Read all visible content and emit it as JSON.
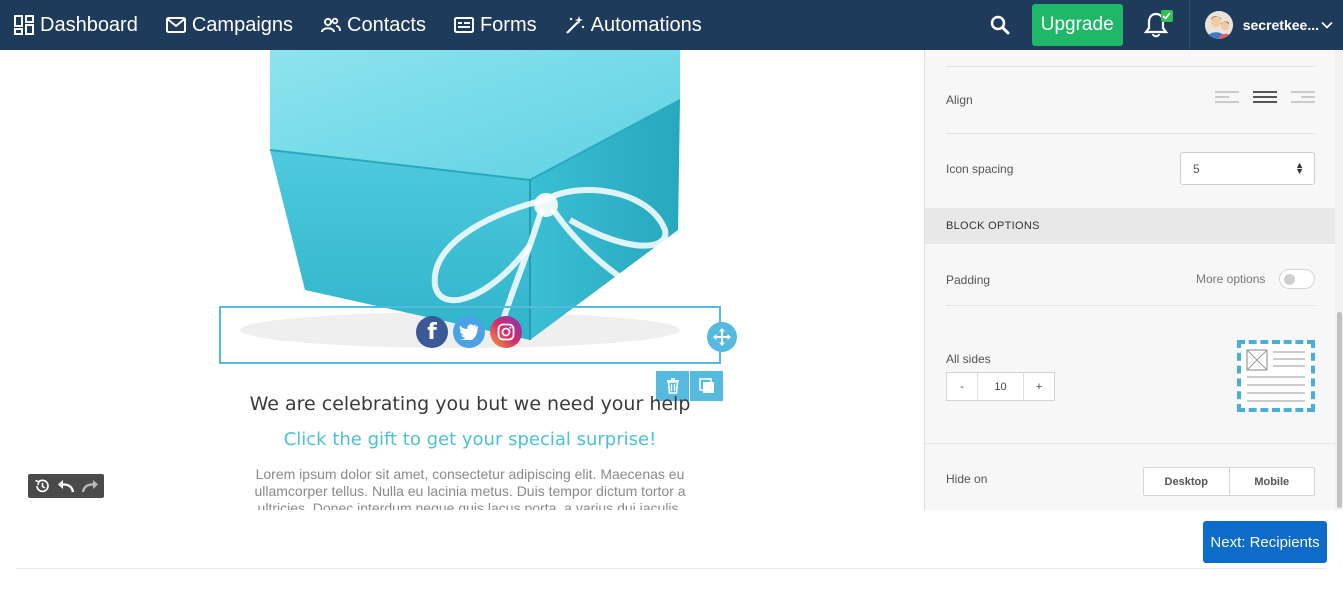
{
  "nav": {
    "items": [
      {
        "label": "Dashboard",
        "icon": "dashboard-icon"
      },
      {
        "label": "Campaigns",
        "icon": "mail-icon"
      },
      {
        "label": "Contacts",
        "icon": "contacts-icon"
      },
      {
        "label": "Forms",
        "icon": "form-icon"
      },
      {
        "label": "Automations",
        "icon": "magic-wand-icon"
      }
    ],
    "upgrade_label": "Upgrade",
    "user_name": "secretkee...",
    "colors": {
      "bar": "#1f3b5c",
      "upgrade": "#1fb868"
    }
  },
  "canvas": {
    "heading": "We are celebrating you but we need your help",
    "subheading": "Click the gift to get your special surprise!",
    "body": "Lorem ipsum dolor sit amet, consectetur adipiscing elit. Maecenas eu ullamcorper tellus. Nulla eu lacinia metus. Duis tempor dictum tortor a ultricies. Donec interdum neque quis lacus porta, a varius dui iaculis.",
    "social": [
      "facebook",
      "twitter",
      "instagram"
    ],
    "accent": "#55b9e0"
  },
  "panel": {
    "align_label": "Align",
    "icon_spacing_label": "Icon spacing",
    "icon_spacing_value": "5",
    "block_options_title": "BLOCK OPTIONS",
    "padding_label": "Padding",
    "more_options_label": "More options",
    "all_sides_label": "All sides",
    "minus": "-",
    "plus": "+",
    "padding_value": "10",
    "hide_on_label": "Hide on",
    "desktop_label": "Desktop",
    "mobile_label": "Mobile"
  },
  "footer": {
    "next_label": "Next: Recipients",
    "next_color": "#0d6bc9"
  }
}
